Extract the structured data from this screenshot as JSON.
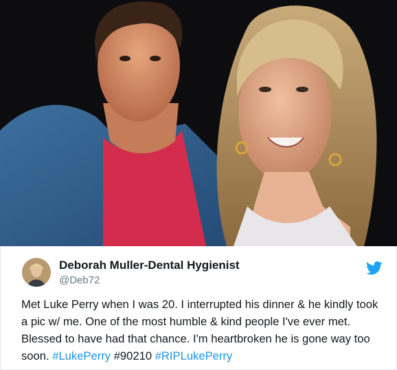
{
  "tweet": {
    "display_name": "Deborah Muller-Dental Hygienist",
    "handle": "@Deb72",
    "body_text": "Met Luke Perry when I was 20. I interrupted his dinner & he kindly took a pic w/ me. One of the most humble & kind people I've ever met. Blessed to have had that chance. I'm heartbroken he is gone way too soon.",
    "hashtag_1": "#LukePerry",
    "hashtag_2": "#90210",
    "hashtag_3": "#RIPLukePerry"
  },
  "colors": {
    "link_blue": "#1b95e0",
    "twitter_blue": "#1da1f2",
    "text": "#14171a",
    "muted": "#657786",
    "border": "#e1e8ed"
  },
  "icons": {
    "brand": "twitter-bird-icon"
  }
}
